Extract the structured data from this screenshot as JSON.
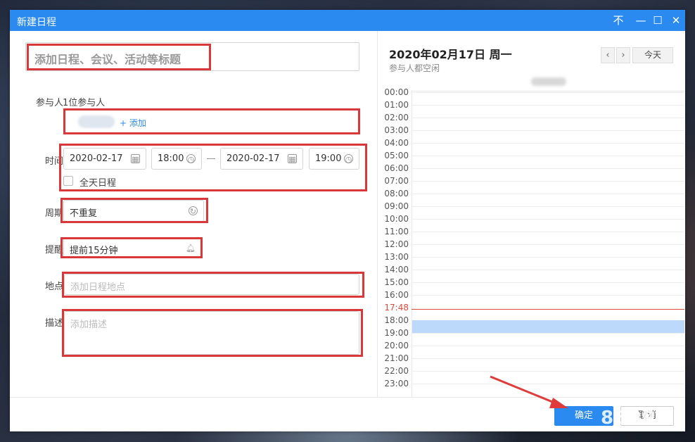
{
  "window": {
    "title": "新建日程",
    "controls": {
      "pin": "不",
      "minimize": "—",
      "maximize": "☐",
      "close": "✕"
    }
  },
  "form": {
    "title_placeholder": "添加日程、会议、活动等标题",
    "participants": {
      "label": "参与人",
      "count_text": "1位参与人",
      "add_text": "+ 添加"
    },
    "time": {
      "label": "时间",
      "start_date": "2020-02-17",
      "start_time": "18:00",
      "end_date": "2020-02-17",
      "end_time": "19:00",
      "all_day_label": "全天日程",
      "all_day_checked": false
    },
    "repeat": {
      "label": "周期",
      "value": "不重复"
    },
    "reminder": {
      "label": "提醒",
      "value": "提前15分钟"
    },
    "location": {
      "label": "地点",
      "placeholder": "添加日程地点"
    },
    "description": {
      "label": "描述",
      "placeholder": "添加描述"
    }
  },
  "calendar": {
    "date_title": "2020年02月17日  周一",
    "availability": "参与人都空闲",
    "prev_icon": "‹",
    "next_icon": "›",
    "today_label": "今天",
    "hours": [
      "00:00",
      "01:00",
      "02:00",
      "03:00",
      "04:00",
      "05:00",
      "06:00",
      "07:00",
      "08:00",
      "09:00",
      "10:00",
      "11:00",
      "12:00",
      "13:00",
      "14:00",
      "15:00",
      "16:00",
      "17:48",
      "18:00",
      "19:00",
      "20:00",
      "21:00",
      "22:00",
      "23:00"
    ],
    "current_time": "17:48",
    "accent_color": "#2a8af0",
    "event_color": "#bcd8fb",
    "now_color": "#e04a3a"
  },
  "footer": {
    "confirm_label": "确定",
    "cancel_label": "取消",
    "watermark": "86PPT"
  }
}
